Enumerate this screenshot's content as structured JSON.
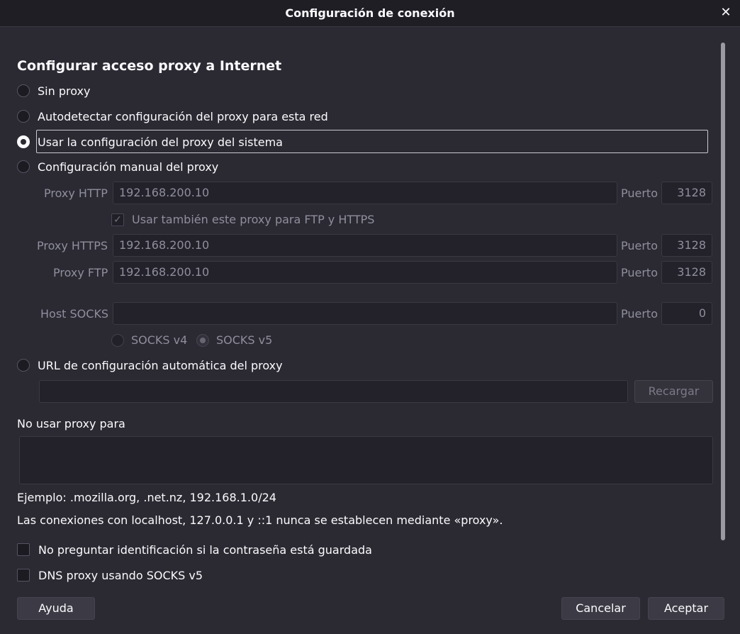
{
  "window": {
    "title": "Configuración de conexión",
    "close_symbol": "✕"
  },
  "heading": "Configurar acceso proxy a Internet",
  "proxy_options": {
    "no_proxy": "Sin proxy",
    "auto_detect": "Autodetectar configuración del proxy para esta red",
    "system": "Usar la configuración del proxy del sistema",
    "manual": "Configuración manual del proxy",
    "auto_url": "URL de configuración automática del proxy",
    "selected": "system"
  },
  "manual": {
    "http_label": "Proxy HTTP",
    "http_value": "192.168.200.10",
    "http_port_label": "Puerto",
    "http_port": "3128",
    "also_use_label": "Usar también este proxy para FTP y HTTPS",
    "also_use_checked": true,
    "https_label": "Proxy HTTPS",
    "https_value": "192.168.200.10",
    "https_port_label": "Puerto",
    "https_port": "3128",
    "ftp_label": "Proxy FTP",
    "ftp_value": "192.168.200.10",
    "ftp_port_label": "Puerto",
    "ftp_port": "3128",
    "socks_label": "Host SOCKS",
    "socks_value": "",
    "socks_port_label": "Puerto",
    "socks_port": "0",
    "socks_v4": "SOCKS v4",
    "socks_v5": "SOCKS v5",
    "socks_selected": "v5"
  },
  "auto_url": {
    "value": "",
    "reload_label": "Recargar"
  },
  "no_proxy": {
    "label": "No usar proxy para",
    "value": ""
  },
  "example_text": "Ejemplo: .mozilla.org, .net.nz, 192.168.1.0/24",
  "localhost_note": "Las conexiones con localhost, 127.0.0.1 y ::1 nunca se establecen mediante «proxy».",
  "checkboxes": {
    "no_prompt_auth": {
      "label": "No preguntar identificación si la contraseña está guardada",
      "checked": false
    },
    "dns_socks": {
      "label": "DNS proxy usando SOCKS v5",
      "checked": false
    }
  },
  "buttons": {
    "help": "Ayuda",
    "cancel": "Cancelar",
    "accept": "Aceptar"
  },
  "colors": {
    "background": "#2b2a33",
    "titlebar": "#1f1e25",
    "text": "#fbfbfe",
    "disabled_text": "#8f8f9d",
    "button": "#3c3b45"
  }
}
